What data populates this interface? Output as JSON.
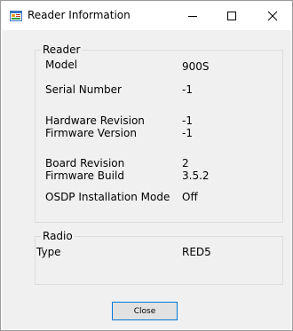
{
  "window": {
    "title": "Reader Information",
    "icon": "app-window-icon"
  },
  "reader": {
    "legend": "Reader",
    "fields": [
      {
        "label": "Model",
        "value": "900S"
      },
      {
        "label": "Serial Number",
        "value": "-1"
      },
      {
        "label": "Hardware Revision",
        "value": "-1"
      },
      {
        "label": "Firmware Version",
        "value": "-1"
      },
      {
        "label": "Board Revision",
        "value": "2"
      },
      {
        "label": "Firmware Build",
        "value": "3.5.2"
      },
      {
        "label": "OSDP Installation Mode",
        "value": "Off"
      }
    ]
  },
  "radio": {
    "legend": "Radio",
    "fields": [
      {
        "label": "Type",
        "value": "RED5"
      }
    ]
  },
  "buttons": {
    "close_label": "Close"
  }
}
